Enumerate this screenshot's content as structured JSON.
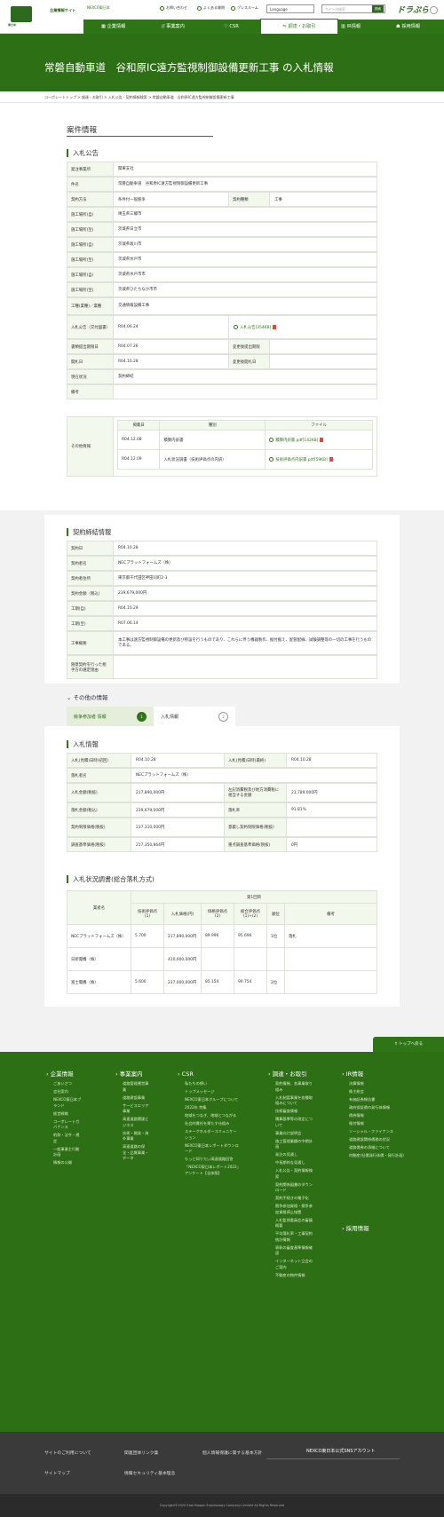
{
  "header": {
    "logo_text": "NEXCO",
    "logo_sub": "東日本",
    "site_title": "企業情報サイト",
    "util_links": [
      "お問い合わせ",
      "よくある質問",
      "プレスルーム"
    ],
    "language": "Language",
    "search_placeholder": "サイト内検索",
    "search_btn": "検索",
    "brand": "ドラぷら",
    "top_link": "NEXCO東日本"
  },
  "nav": {
    "items": [
      "企業情報",
      "事業案内",
      "CSR",
      "調達・お取引",
      "IR情報",
      "採用情報"
    ],
    "active": "調達・お取引"
  },
  "page": {
    "title": "常磐自動車道　谷和原IC遠方監視制御設備更新工事 の入札情報",
    "breadcrumb": [
      "コーポレートトップ",
      "調達・お取引",
      "入札公告・契約情報検索",
      "常磐自動車道　谷和原IC遠方監視制御設備更新工事"
    ]
  },
  "case": {
    "title": "案件情報",
    "notice_title": "入札公告",
    "rows": [
      {
        "k": "発注事業所",
        "v": "関東支社"
      },
      {
        "k": "件名",
        "v": "常磐自動車道　谷和原IC遠方監視制御設備更新工事"
      },
      {
        "k": "契約方法",
        "v": "条件付一般競争",
        "k2": "契約種類",
        "v2": "工事"
      },
      {
        "k": "施工場所(自)",
        "v": "埼玉県三郷市"
      },
      {
        "k": "施工場所(至)",
        "v": "茨城県日立市"
      },
      {
        "k": "施工場所(自)",
        "v": "茨城県坂川市"
      },
      {
        "k": "施工場所(至)",
        "v": "茨城県水戸市"
      },
      {
        "k": "施工場所(自)",
        "v": "茨城県水戸市市"
      },
      {
        "k": "施工場所(至)",
        "v": "茨城県ひたちなか市市"
      },
      {
        "k": "工種(業種)／業種",
        "v": "交通情報設備工事"
      },
      {
        "k": "入札公告（交付図書）",
        "v": "R04.06.24",
        "file": "入札公告[354KB]"
      },
      {
        "k": "書類提出期限日",
        "v": "R04.07.26",
        "k2": "変更後提出期限",
        "v2": ""
      },
      {
        "k": "開札日",
        "v": "R04.10.28",
        "k2": "変更後開札日",
        "v2": ""
      },
      {
        "k": "現在状況",
        "v": "契約締結"
      },
      {
        "k": "備考",
        "v": ""
      }
    ],
    "other_label": "その他情報",
    "other_headers": [
      "掲載日",
      "種別",
      "ファイル"
    ],
    "other_rows": [
      {
        "date": "R04.12.08",
        "type": "積算内訳書",
        "file": "積算内訳書.pdf[142KB]"
      },
      {
        "date": "R04.12.09",
        "type": "入札状況調書（技術評価点の内訳）",
        "file": "技術評価点内訳書.pdf[59KB]"
      }
    ]
  },
  "contract": {
    "title": "契約締結情報",
    "rows": [
      {
        "k": "契約日",
        "v": "R04.10.28"
      },
      {
        "k": "契約者名",
        "v": "NECプラットフォームズ（株）"
      },
      {
        "k": "契約者住所",
        "v": "東京都千代田区神田司町2-3"
      },
      {
        "k": "契約金額（税込）",
        "v": "239,679,000円"
      },
      {
        "k": "工期(自)",
        "v": "R04.10.29"
      },
      {
        "k": "工期(至)",
        "v": "R07.06.14"
      },
      {
        "k": "工事概要",
        "v": "本工事は遠方監視制御設備の更新及び移設を行うものであり、これらに伴う機器製作、据付据え、配管配線、試験調整等の一切の工事を行うものである。"
      },
      {
        "k": "随意契約を行った相手方の選定理由",
        "v": ""
      }
    ]
  },
  "other": {
    "title": "その他の情報",
    "tabs": [
      {
        "label": "競争参加者 情報",
        "badge": "1"
      },
      {
        "label": "入札情報",
        "badge": "2"
      }
    ]
  },
  "bid": {
    "title": "入札情報",
    "rows": [
      {
        "k": "入札(見積)日時(初回)",
        "v": "R04.10.28",
        "k2": "入札(見積)日時(最終)",
        "v2": "R04.10.28"
      },
      {
        "k": "落札者名",
        "v": "NECプラットフォームズ（株）"
      },
      {
        "k": "入札金額(税抜)",
        "v": "217,890,000円",
        "k2": "左記消費税及び地方消費税に相当する金額",
        "v2": "21,789,000円"
      },
      {
        "k": "落札金額(税込)",
        "v": "239,679,000円",
        "k2": "落札率",
        "v2": "91.81%"
      },
      {
        "k": "契約制限価格(税抜)",
        "v": "237,310,000円",
        "k2": "意義し契約制限価格(税抜)",
        "v2": ""
      },
      {
        "k": "調査基準価格(税抜)",
        "v": "217,350,864円",
        "k2": "重点調査基準価格(税抜)",
        "v2": "0円"
      }
    ]
  },
  "status": {
    "title": "入札状況調書(総合落札方式)",
    "round": "第1回目",
    "headers": [
      "業者名",
      "技術評価点(1)",
      "入札価格(円)",
      "価格評価点(2)",
      "総合評価点(1)+(2)",
      "順位",
      "備考"
    ],
    "rows": [
      {
        "name": "NECプラットフォームズ（株）",
        "tech": "5.700",
        "price": "217,890,000円",
        "peval": "89.996",
        "total": "95.696",
        "rank": "1位",
        "note": "落札"
      },
      {
        "name": "日新電機（株）",
        "tech": "",
        "price": "410,000,000円",
        "peval": "",
        "total": "",
        "rank": "",
        "note": ""
      },
      {
        "name": "富士電機（株）",
        "tech": "5.600",
        "price": "237,000,000円",
        "peval": "85.154",
        "total": "90.754",
        "rank": "2位",
        "note": ""
      }
    ]
  },
  "totop": "トップへ戻る",
  "footer": {
    "cols": [
      {
        "title": "企業情報",
        "links": [
          "ごあいさつ",
          "会社案内",
          "NEXCO東日本ブランド",
          "経営戦略",
          "コーポレートガバナンス",
          "約款・法令・規定",
          "一般事業主行動計画",
          "情報の公開"
        ]
      },
      {
        "title": "事業案内",
        "links": [
          "道路管理運営事業",
          "道路建設事業",
          "サービスエリア事業",
          "高速道路関連ビジネス",
          "技術・開発・海外事業",
          "高速道路の保全・品質事業・データ"
        ]
      },
      {
        "title": "CSR",
        "links": [
          "私たちの想い",
          "トップメッセージ",
          "NEXCO東日本グループについて",
          "2022年 特集",
          "地域をつなぎ、地域とつながる",
          "社会的責任を果たす仕組み",
          "ステークホルダーコミュニケーション",
          "NEXCO東日本レポートダウンロード",
          "もっと知りたい高速道路回答",
          "「NEXCO東日本レポート2022」アンケート【全体版】"
        ]
      },
      {
        "title": "調達・お取引",
        "links": [
          "契約情報、各事業取り組み",
          "入札制度事業を各種取組みについて",
          "技術審査情報",
          "積算基準等の改定について",
          "事業向け説明会",
          "施工管理業績の中期計画",
          "発注の見通し",
          "中長期的な見通し",
          "入札公告・契約情報検索",
          "契約関係図書のダウンロード",
          "契約手続きの電子化",
          "競争参加資格・競争参加資格停止措置",
          "入札監視委員会の審議概要",
          "平均落札率・工事契約統計情報",
          "表彰の審査基準情報確認",
          "インターネット立会のご案内",
          "不動産の物件情報"
        ]
      },
      {
        "title": "IR情報",
        "links": [
          "決算情報",
          "株主総会",
          "有価証券報告書",
          "政府保証債の発行体情報",
          "債券情報",
          "格付情報",
          "ソーシャル・ファイナンス",
          "道路建設関係債務の状況",
          "道路債券の承継について",
          "何動産(社債発行体債・発行計画)"
        ]
      },
      {
        "title": "採用情報",
        "links": []
      }
    ]
  },
  "bottom": {
    "links": [
      "サイトのご利用について",
      "関連団体リンク集",
      "個人情報保護に関する基本方針",
      "サイトマップ",
      "情報セキュリティ基本理念"
    ],
    "sns": "NEXCO東日本公式SNSアカウント",
    "copyright": "Copyright©2020 East Nippon Expressway Company Limited All Rights Reserved"
  },
  "colors": {
    "primary": "#2f7517",
    "hero": "#2d6f14",
    "pale": "#f3f8ec"
  }
}
